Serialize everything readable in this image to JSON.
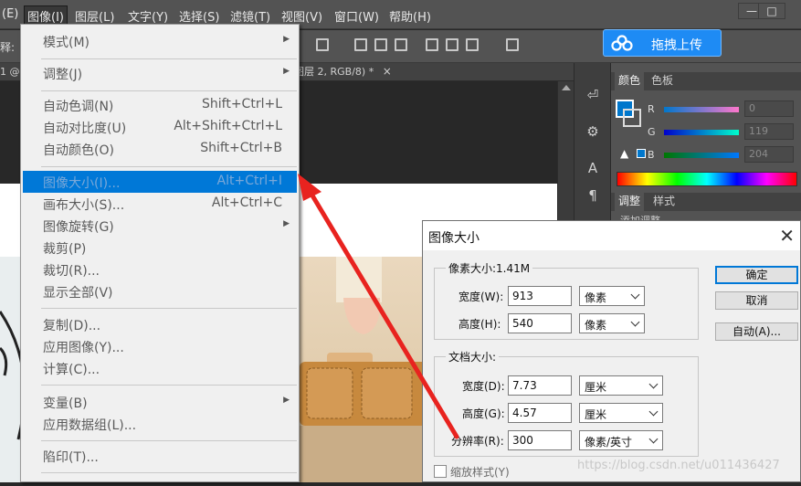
{
  "menubar": {
    "items": [
      {
        "label": "(E)"
      },
      {
        "label": "图像(I)"
      },
      {
        "label": "图层(L)"
      },
      {
        "label": "文字(Y)"
      },
      {
        "label": "选择(S)"
      },
      {
        "label": "滤镜(T)"
      },
      {
        "label": "视图(V)"
      },
      {
        "label": "窗口(W)"
      },
      {
        "label": "帮助(H)"
      }
    ],
    "minimize": "—",
    "maximize": "□"
  },
  "options_bar": {
    "left_label": "释:"
  },
  "upload": {
    "label": "拖拽上传"
  },
  "doc_tab": {
    "left": "1 @",
    "title": "图层 2, RGB/8) *",
    "close": "×"
  },
  "menu": {
    "items": [
      {
        "label": "模式(M)",
        "shortcut": "",
        "submenu": true
      },
      {
        "label": "调整(J)",
        "shortcut": "",
        "submenu": true
      },
      {
        "label": "自动色调(N)",
        "shortcut": "Shift+Ctrl+L"
      },
      {
        "label": "自动对比度(U)",
        "shortcut": "Alt+Shift+Ctrl+L"
      },
      {
        "label": "自动颜色(O)",
        "shortcut": "Shift+Ctrl+B"
      },
      {
        "label": "图像大小(I)...",
        "shortcut": "Alt+Ctrl+I",
        "highlighted": true
      },
      {
        "label": "画布大小(S)...",
        "shortcut": "Alt+Ctrl+C"
      },
      {
        "label": "图像旋转(G)",
        "shortcut": "",
        "submenu": true
      },
      {
        "label": "裁剪(P)",
        "shortcut": ""
      },
      {
        "label": "裁切(R)...",
        "shortcut": ""
      },
      {
        "label": "显示全部(V)",
        "shortcut": ""
      },
      {
        "label": "复制(D)...",
        "shortcut": ""
      },
      {
        "label": "应用图像(Y)...",
        "shortcut": ""
      },
      {
        "label": "计算(C)...",
        "shortcut": ""
      },
      {
        "label": "变量(B)",
        "shortcut": "",
        "submenu": true
      },
      {
        "label": "应用数据组(L)...",
        "shortcut": ""
      },
      {
        "label": "陷印(T)...",
        "shortcut": ""
      }
    ]
  },
  "color_panel": {
    "tabs": [
      "颜色",
      "色板"
    ],
    "r": {
      "label": "R",
      "value": "0"
    },
    "g": {
      "label": "G",
      "value": "119"
    },
    "b": {
      "label": "B",
      "value": "204"
    },
    "foreground": "#0077cc"
  },
  "adjust_panel": {
    "tabs": [
      "调整",
      "样式"
    ],
    "hint": "添加调整"
  },
  "dialog": {
    "title": "图像大小",
    "close": "✕",
    "pixel_group": {
      "label": "像素大小:1.41M",
      "width_label": "宽度(W):",
      "width": "913",
      "width_unit": "像素",
      "height_label": "高度(H):",
      "height": "540",
      "height_unit": "像素"
    },
    "doc_group": {
      "label": "文档大小:",
      "width_label": "宽度(D):",
      "width": "7.73",
      "width_unit": "厘米",
      "height_label": "高度(G):",
      "height": "4.57",
      "height_unit": "厘米",
      "res_label": "分辨率(R):",
      "res": "300",
      "res_unit": "像素/英寸"
    },
    "buttons": {
      "ok": "确定",
      "cancel": "取消",
      "auto": "自动(A)..."
    },
    "scale_styles": "缩放样式(Y)"
  },
  "watermark": "https://blog.csdn.net/u011436427",
  "accent_colors": {
    "highlight": "#0078d7",
    "arrow": "#e8231f",
    "upload": "#1e8bf4"
  }
}
